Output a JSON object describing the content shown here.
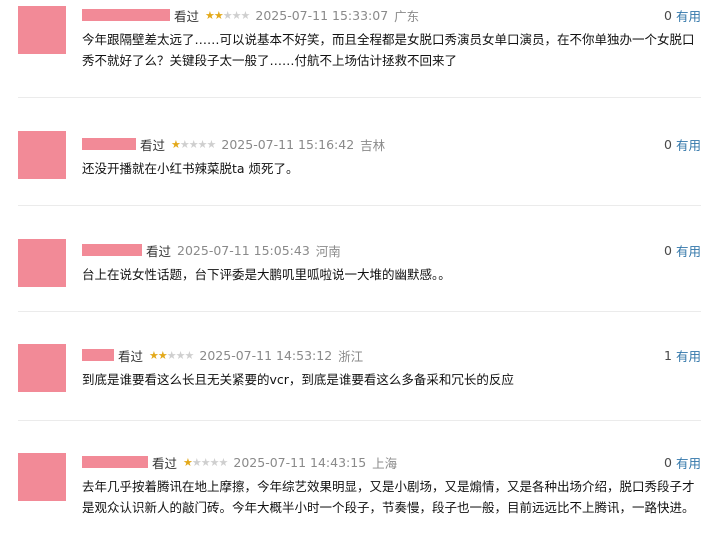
{
  "reviews": [
    {
      "tag": "看过",
      "stars": 2,
      "time": "2025-07-11 15:33:07",
      "location": "广东",
      "useful_count": "0",
      "useful_label": "有用",
      "content": "今年跟隔壁差太远了……可以说基本不好笑，而且全程都是女脱口秀演员女单口演员，在不你单独办一个女脱口秀不就好了么？关键段子太一般了……付航不上场估计拯救不回来了"
    },
    {
      "tag": "看过",
      "stars": 1,
      "time": "2025-07-11 15:16:42",
      "location": "吉林",
      "useful_count": "0",
      "useful_label": "有用",
      "content": "还没开播就在小红书辣菜脱ta 烦死了。"
    },
    {
      "tag": "看过",
      "stars": 0,
      "time": "2025-07-11 15:05:43",
      "location": "河南",
      "useful_count": "0",
      "useful_label": "有用",
      "content": "台上在说女性话题，台下评委是大鹏叽里呱啦说一大堆的幽默感。。"
    },
    {
      "tag": "看过",
      "stars": 2,
      "time": "2025-07-11 14:53:12",
      "location": "浙江",
      "useful_count": "1",
      "useful_label": "有用",
      "content": "到底是谁要看这么长且无关紧要的vcr，到底是谁要看这么多备采和冗长的反应"
    },
    {
      "tag": "看过",
      "stars": 1,
      "time": "2025-07-11 14:43:15",
      "location": "上海",
      "useful_count": "0",
      "useful_label": "有用",
      "content": "去年几乎按着腾讯在地上摩擦，今年综艺效果明显，又是小剧场，又是煽情，又是各种出场介绍，脱口秀段子才是观众认识新人的敲门砖。今年大概半小时一个段子，节奏慢，段子也一般，目前远远比不上腾讯，一路快进。"
    }
  ],
  "colors": {
    "star_on": "#e3a91a",
    "star_off": "#cfcfcf",
    "avatar_mask": "#f28a97",
    "useful_link": "#3377aa"
  }
}
